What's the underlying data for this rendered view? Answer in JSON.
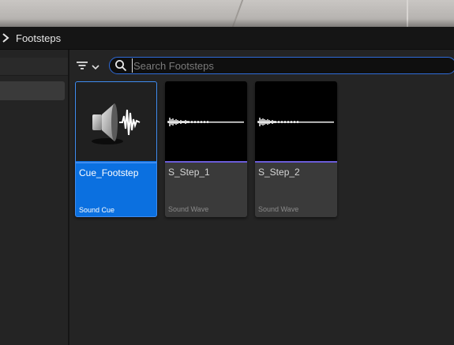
{
  "breadcrumb": {
    "folder": "Footsteps"
  },
  "search": {
    "placeholder": "Search Footsteps",
    "value": ""
  },
  "assets": [
    {
      "name": "Cue_Footstep",
      "type": "Sound Cue",
      "selected": true,
      "icon": "speaker-icon"
    },
    {
      "name": "S_Step_1",
      "type": "Sound Wave",
      "selected": false,
      "icon": "waveform-icon"
    },
    {
      "name": "S_Step_2",
      "type": "Sound Wave",
      "selected": false,
      "icon": "waveform-icon"
    }
  ],
  "colors": {
    "selection": "#0b70e0",
    "sound_wave_accent": "#6a5cd8",
    "search_border": "#2f6bd8"
  }
}
